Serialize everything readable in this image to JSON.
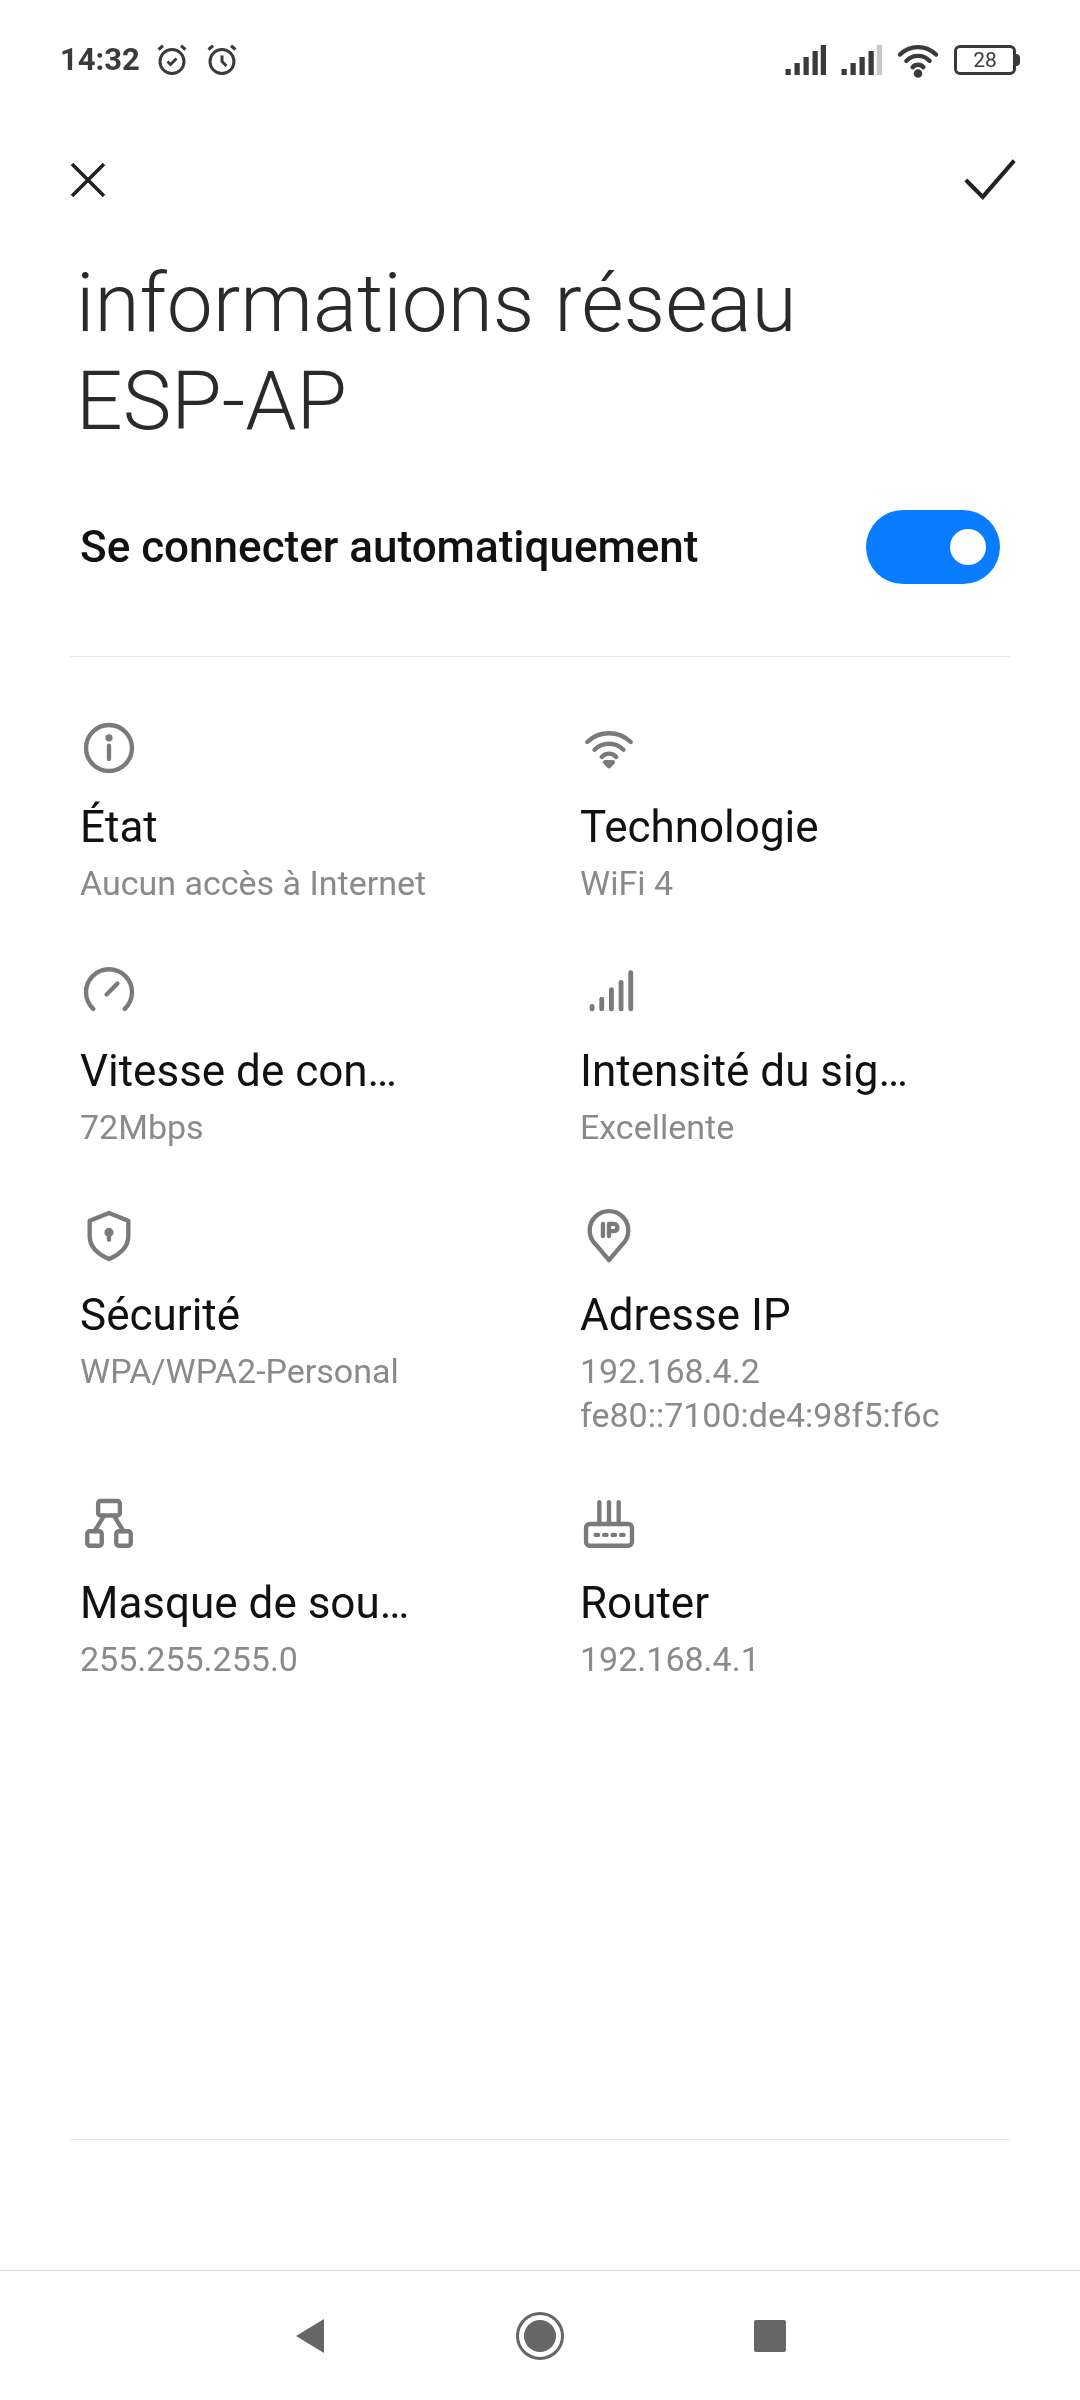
{
  "status_bar": {
    "time": "14:32",
    "battery": "28"
  },
  "title": "informations réseau ESP-AP",
  "auto_connect": {
    "label": "Se connecter automatiquement",
    "on": true
  },
  "details": [
    {
      "kind": "info",
      "label": "État",
      "values": [
        "Aucun accès à Internet"
      ]
    },
    {
      "kind": "wifi",
      "label": "Technologie",
      "values": [
        "WiFi 4"
      ]
    },
    {
      "kind": "speed",
      "label": "Vitesse de con…",
      "values": [
        "72Mbps"
      ]
    },
    {
      "kind": "signal",
      "label": "Intensité du sig…",
      "values": [
        "Excellente"
      ]
    },
    {
      "kind": "security",
      "label": "Sécurité",
      "values": [
        "WPA/WPA2-Personal"
      ]
    },
    {
      "kind": "ip",
      "label": "Adresse IP",
      "values": [
        "192.168.4.2",
        "fe80::7100:de4:98f5:f6c"
      ]
    },
    {
      "kind": "subnet",
      "label": "Masque de sou…",
      "values": [
        "255.255.255.0"
      ]
    },
    {
      "kind": "router",
      "label": "Router",
      "values": [
        "192.168.4.1"
      ]
    }
  ]
}
